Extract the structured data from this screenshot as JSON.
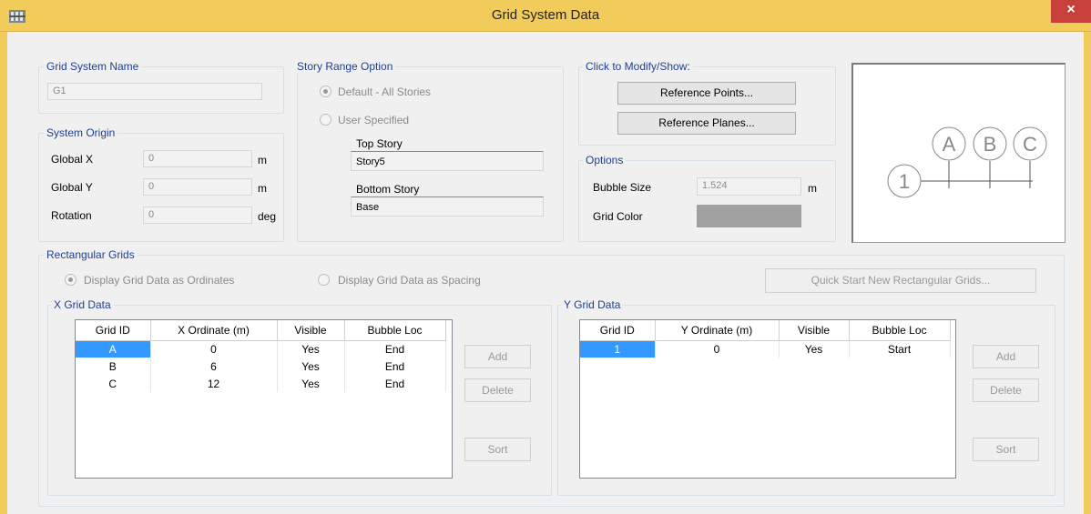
{
  "window": {
    "title": "Grid System Data",
    "close_label": "×"
  },
  "grid_system_name": {
    "group_label": "Grid System Name",
    "value": "G1"
  },
  "system_origin": {
    "group_label": "System Origin",
    "global_x_label": "Global X",
    "global_x_value": "0",
    "global_x_unit": "m",
    "global_y_label": "Global Y",
    "global_y_value": "0",
    "global_y_unit": "m",
    "rotation_label": "Rotation",
    "rotation_value": "0",
    "rotation_unit": "deg"
  },
  "story_range": {
    "group_label": "Story Range Option",
    "default_label": "Default - All Stories",
    "user_label": "User Specified",
    "top_story_label": "Top Story",
    "top_story_value": "Story5",
    "bottom_story_label": "Bottom Story",
    "bottom_story_value": "Base"
  },
  "click_modify": {
    "group_label": "Click to Modify/Show:",
    "ref_points_label": "Reference Points...",
    "ref_planes_label": "Reference Planes..."
  },
  "options": {
    "group_label": "Options",
    "bubble_size_label": "Bubble Size",
    "bubble_size_value": "1.524",
    "bubble_size_unit": "m",
    "grid_color_label": "Grid Color",
    "grid_color": "#a0a0a0"
  },
  "preview": {
    "bubbles_x": [
      "A",
      "B",
      "C"
    ],
    "bubble_y": "1"
  },
  "rect_grids": {
    "group_label": "Rectangular Grids",
    "ordinates_label": "Display Grid Data as Ordinates",
    "spacing_label": "Display Grid Data as Spacing",
    "quick_start_label": "Quick Start New Rectangular Grids..."
  },
  "x_grid": {
    "group_label": "X Grid Data",
    "headers": [
      "Grid ID",
      "X Ordinate (m)",
      "Visible",
      "Bubble Loc"
    ],
    "rows": [
      [
        "A",
        "0",
        "Yes",
        "End"
      ],
      [
        "B",
        "6",
        "Yes",
        "End"
      ],
      [
        "C",
        "12",
        "Yes",
        "End"
      ]
    ],
    "add_label": "Add",
    "delete_label": "Delete",
    "sort_label": "Sort"
  },
  "y_grid": {
    "group_label": "Y Grid Data",
    "headers": [
      "Grid ID",
      "Y Ordinate (m)",
      "Visible",
      "Bubble Loc"
    ],
    "rows": [
      [
        "1",
        "0",
        "Yes",
        "Start"
      ]
    ],
    "add_label": "Add",
    "delete_label": "Delete",
    "sort_label": "Sort"
  }
}
